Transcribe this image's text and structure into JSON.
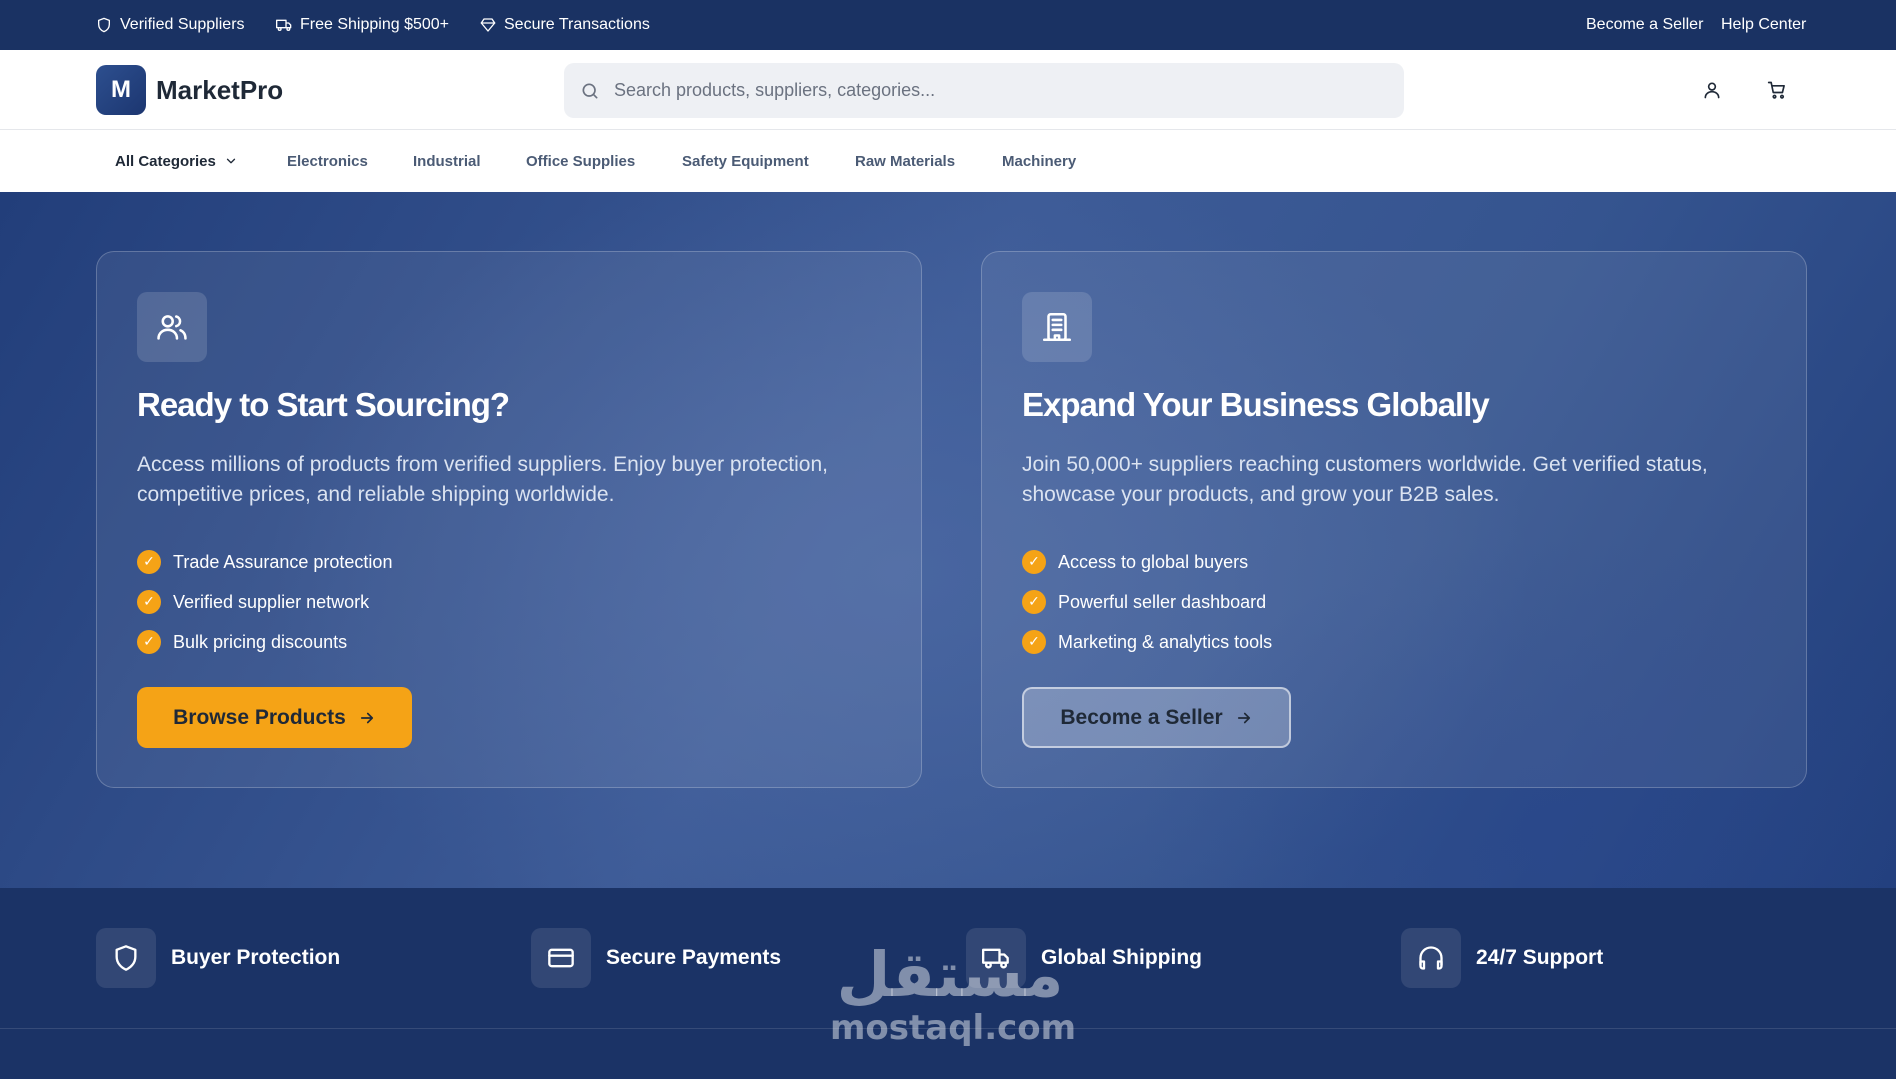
{
  "topbar": {
    "badges": [
      "Verified Suppliers",
      "Free Shipping $500+",
      "Secure Transactions"
    ],
    "links": [
      "Become a Seller",
      "Help Center"
    ]
  },
  "header": {
    "logo_letter": "M",
    "brand": "MarketPro",
    "search_placeholder": "Search products, suppliers, categories..."
  },
  "nav": {
    "all_categories": "All Categories",
    "categories": [
      "Electronics",
      "Industrial",
      "Office Supplies",
      "Safety Equipment",
      "Raw Materials",
      "Machinery"
    ]
  },
  "hero": {
    "buyer_card": {
      "icon": "users-icon",
      "title": "Ready to Start Sourcing?",
      "description": "Access millions of products from verified suppliers. Enjoy buyer protection, competitive prices, and reliable shipping worldwide.",
      "bullets": [
        "Trade Assurance protection",
        "Verified supplier network",
        "Bulk pricing discounts"
      ],
      "cta": "Browse Products"
    },
    "seller_card": {
      "icon": "building-icon",
      "title": "Expand Your Business Globally",
      "description": "Join 50,000+ suppliers reaching customers worldwide. Get verified status, showcase your products, and grow your B2B sales.",
      "bullets": [
        "Access to global buyers",
        "Powerful seller dashboard",
        "Marketing & analytics tools"
      ],
      "cta": "Become a Seller"
    }
  },
  "features": [
    "Buyer Protection",
    "Secure Payments",
    "Global Shipping",
    "24/7 Support"
  ],
  "watermark": {
    "arabic": "مستقل",
    "latin": "mostaql.com"
  },
  "colors": {
    "navy": "#1a3263",
    "accent": "#f5a316",
    "white": "#ffffff"
  }
}
